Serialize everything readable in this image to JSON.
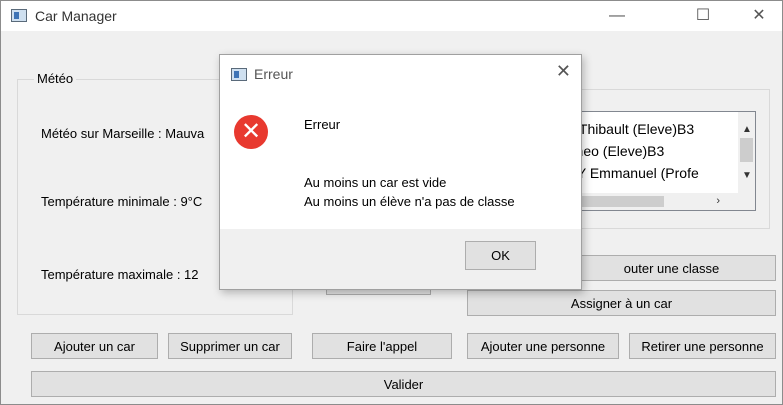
{
  "window": {
    "title": "Car Manager",
    "controls": {
      "minimize": "—",
      "maximize": "☐",
      "close": "✕"
    }
  },
  "meteo": {
    "group_title": "Météo",
    "weather": "Météo sur Marseille : Mauva",
    "min_temp": "Température minimale : 9°C",
    "max_temp": "Température maximale : 12"
  },
  "people_list": {
    "items": [
      "T Thibault (Eleve)B3",
      "rtheo (Eleve)B3",
      "RY Emmanuel (Profe"
    ]
  },
  "buttons": {
    "ajouter_classe": "outer une classe",
    "assigner_car": "Assigner à un car",
    "ajouter_car": "Ajouter un car",
    "supprimer_car": "Supprimer un car",
    "faire_appel": "Faire l'appel",
    "ajouter_personne": "Ajouter une personne",
    "retirer_personne": "Retirer une personne",
    "valider": "Valider"
  },
  "dialog": {
    "title": "Erreur",
    "close": "✕",
    "heading": "Erreur",
    "line1": "Au moins un car est vide",
    "line2": "Au moins un élève n'a pas de classe",
    "ok": "OK",
    "icon_glyph": "✕"
  }
}
